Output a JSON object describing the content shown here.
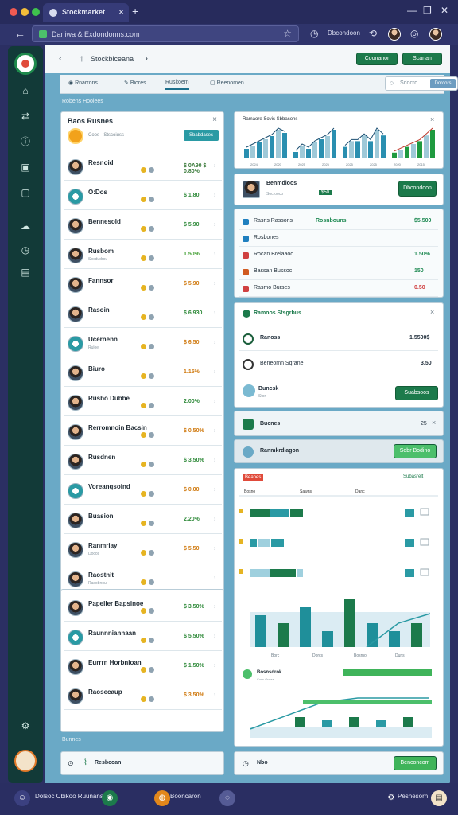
{
  "browser": {
    "tab_title": "Stockmarket",
    "address": "Daniwa & Exdondonns.com",
    "profile_label": "Dbcondoon"
  },
  "topbar": {
    "title": "Stockbiceana",
    "btn_primary": "Coonanor",
    "btn_secondary": "Scanan"
  },
  "tabs": [
    {
      "label": "Rnarrons"
    },
    {
      "label": "Biores"
    },
    {
      "label": "Rusitoem"
    },
    {
      "label": "Reenomen"
    }
  ],
  "search": {
    "placeholder": "Sdocro",
    "button": "Dorcors"
  },
  "breadcrumb": "Robens Hoolees",
  "list_panel": {
    "title": "Baos Rusnes",
    "subtitle": "Coos - Stscoiuss",
    "pill": "Sbabdases",
    "rows": [
      {
        "name": "Resnoid",
        "sub": "",
        "value": "$ 0A90 $ 0.80%",
        "color": "#3a7a3a"
      },
      {
        "name": "O:Dos",
        "sub": "",
        "value": "$ 1.80",
        "color": "#2f8a3a"
      },
      {
        "name": "Bennesold",
        "sub": "",
        "value": "$ 5.90",
        "color": "#2f8a3a"
      },
      {
        "name": "Rusbom",
        "sub": "Socdudrou",
        "value": "1.50%",
        "color": "#3a9a2a"
      },
      {
        "name": "Fannsor",
        "sub": "",
        "value": "$ 5.90",
        "color": "#d07a10"
      },
      {
        "name": "Rasoin",
        "sub": "",
        "value": "$ 6.930",
        "color": "#2f8a3a"
      },
      {
        "name": "Ucernenn",
        "sub": "Ruloe",
        "value": "$ 6.50",
        "color": "#d07a10"
      },
      {
        "name": "Biuro",
        "sub": "",
        "value": "1.15%",
        "color": "#d07a10"
      },
      {
        "name": "Rusbo Dubbe",
        "sub": "",
        "value": "2.00%",
        "color": "#2f8a3a"
      },
      {
        "name": "Rerromnoin Bacsin",
        "sub": "",
        "value": "$ 0.50%",
        "color": "#d07a10"
      },
      {
        "name": "Rusdnen",
        "sub": "",
        "value": "$ 3.50%",
        "color": "#2f8a3a"
      },
      {
        "name": "Voreanqsoind",
        "sub": "",
        "value": "$ 0.00",
        "color": "#d07a10"
      },
      {
        "name": "Buasion",
        "sub": "",
        "value": "2.20%",
        "color": "#2f8a3a"
      },
      {
        "name": "Ranmriay",
        "sub": "Docos",
        "value": "$ 5.50",
        "color": "#d07a10"
      },
      {
        "name": "Raostnit",
        "sub": "Rasobnou",
        "value": "",
        "color": "#2f8a3a"
      }
    ]
  },
  "list_panel2": {
    "rows": [
      {
        "name": "Papeller Bapsinoe",
        "sub": "",
        "value": "$ 3.50%",
        "color": "#2f8a3a"
      },
      {
        "name": "Raunnniannaan",
        "sub": "",
        "value": "$ 5.50%",
        "color": "#2f8a3a"
      },
      {
        "name": "Eurrrn Horbnioan",
        "sub": "",
        "value": "$ 1.50%",
        "color": "#2f8a3a"
      },
      {
        "name": "Raosecaup",
        "sub": "",
        "value": "$ 3.50%",
        "color": "#d07a10"
      }
    ]
  },
  "list_footer": "Bunnes",
  "bottom_left": "Resbcoan",
  "bottom_right": "Nbo",
  "bottom_right_btn": "Benconcom",
  "chart_panel": {
    "title": "Ramaore Sovis Sbbasons",
    "chart_data": {
      "type": "bar",
      "series": [
        {
          "values": [
            3,
            4,
            5,
            6,
            7,
            9,
            8
          ]
        },
        {
          "values": [
            2,
            4,
            3,
            5,
            6,
            7,
            9
          ]
        },
        {
          "values": [
            2,
            3,
            3,
            4,
            3,
            5,
            4
          ]
        },
        {
          "values": [
            2,
            3,
            4,
            5,
            6,
            8,
            10
          ]
        }
      ]
    },
    "ticks": [
      "2024",
      "2020",
      "2025",
      "2025",
      "2025",
      "2025",
      "2020",
      "2015"
    ]
  },
  "profile_card": {
    "name": "Benmdioos",
    "sub": "Socrooco",
    "badge": "$50",
    "button": "Dbcondoon"
  },
  "stat_list": [
    {
      "name": "Rasns Rassons",
      "mid": "Rosnbouns",
      "value": "$5.500",
      "color": "#1f8a53",
      "icon": "#1f7fbf"
    },
    {
      "name": "Rosbones",
      "mid": "",
      "value": "",
      "color": "#1f8a53",
      "icon": "#1f7fbf"
    },
    {
      "name": "Rocan Breiaaoo",
      "mid": "",
      "value": "1.50%",
      "color": "#1f8a53",
      "icon": "#d04040"
    },
    {
      "name": "Bassan Bussoc",
      "mid": "",
      "value": "150",
      "color": "#1f8a53",
      "icon": "#d05a20"
    },
    {
      "name": "Rasmo Burses",
      "mid": "",
      "value": "0.50",
      "color": "#d04040",
      "icon": "#d04040"
    }
  ],
  "portfolio": {
    "title": "Ramnos Stsgrbus",
    "rows": [
      {
        "name": "Ranoss",
        "value": "1.5500$"
      },
      {
        "name": "Beneomn Sqrane",
        "value": "3.50"
      }
    ],
    "foot": "Buncsk",
    "foot_sub": "Stor",
    "button": "Suabsoos"
  },
  "mini_panel": {
    "title": "Bucnes",
    "value": "25"
  },
  "notice": {
    "title": "Ranmkrdiagon",
    "button": "Sobr Bodino"
  },
  "big_chart": {
    "badge": "Beanes",
    "link": "Subasrelt",
    "cols": [
      "Bosno",
      "Sawns",
      "Danc"
    ],
    "bottom_ticks": [
      "Borc",
      "Dorcs",
      "Bosrno",
      "Duns"
    ],
    "chart_data": {
      "type": "bar",
      "series": [
        {
          "values": [
            3,
            3,
            2
          ]
        },
        {
          "values": [
            1,
            2,
            2
          ]
        },
        {
          "values": [
            3,
            4,
            1
          ]
        },
        {
          "values": [
            4,
            3,
            5,
            2,
            6,
            3,
            2,
            3
          ]
        }
      ]
    }
  },
  "bottom_chart": {
    "title": "Bosnsdrok",
    "sub": "Coss Onoss",
    "chart_data": {
      "type": "line",
      "values": [
        2,
        5,
        8,
        9,
        9,
        9
      ]
    }
  },
  "taskbar": {
    "app1": "Dolsoc Cbikoo Ruunans",
    "app2": "Booncaron",
    "clock": "Pesnesorn"
  },
  "colors": {
    "accent": "#1c7a4b",
    "page_bg": "#6aa9c6",
    "rail": "#123a38"
  }
}
